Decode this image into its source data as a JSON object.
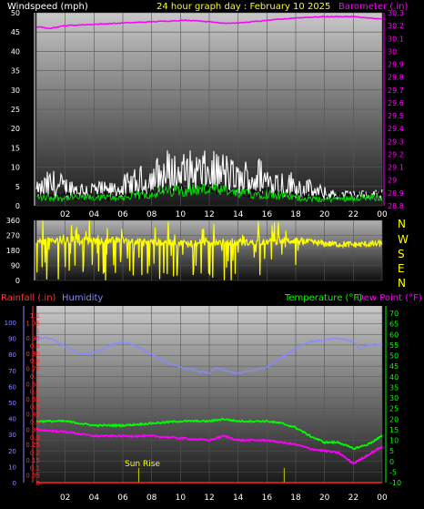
{
  "header": {
    "left": "Windspeed (mph)",
    "center": "24 hour graph day : February 10 2025",
    "right": "Barometer (.in)"
  },
  "compass_letters": [
    "N",
    "W",
    "S",
    "E",
    "N"
  ],
  "colors": {
    "wind": "#ffffff",
    "gust": "#000000",
    "avg": "#00dd00",
    "barometer": "#ff00ff",
    "direction": "#ffff00",
    "humidity": "#8888ff",
    "temperature": "#00ff00",
    "dewpoint": "#ff00ff",
    "rain": "#ff2222",
    "sunline": "#cccc00"
  },
  "x_ticks": [
    "02",
    "04",
    "06",
    "08",
    "10",
    "12",
    "14",
    "16",
    "18",
    "20",
    "22",
    "00"
  ],
  "bottom_header": {
    "rain_label": "Rainfall (.in)",
    "humidity_label": "Humidity",
    "temp_label": "Temperature (°F)",
    "dew_label": "Dew Point (°F)"
  },
  "annotations": {
    "sunrise": "Sun Rise"
  },
  "chart_data": [
    {
      "type": "line",
      "name": "wind",
      "xlim": [
        0,
        24
      ],
      "ylim_left": [
        0,
        50
      ],
      "ylim_right": [
        28.8,
        30.3
      ],
      "left_ticks": [
        0,
        5,
        10,
        15,
        20,
        25,
        30,
        35,
        40,
        45,
        50
      ],
      "right_ticks": [
        "28.8",
        "28.9",
        "29",
        "29.1",
        "29.2",
        "29.3",
        "29.4",
        "29.5",
        "29.6",
        "29.7",
        "29.8",
        "29.9",
        "30",
        "30.1",
        "30.2",
        "30.3"
      ],
      "windspeed_max": {
        "x": [
          0,
          1,
          2,
          3,
          4,
          5,
          6,
          7,
          8,
          9,
          10,
          11,
          12,
          13,
          14,
          15,
          16,
          17,
          18,
          19,
          20,
          21,
          22,
          23,
          24
        ],
        "y": [
          6,
          10,
          8,
          7,
          7,
          6,
          8,
          10,
          12,
          15,
          14,
          15,
          14,
          15,
          11,
          14,
          12,
          10,
          9,
          7,
          5,
          4,
          4,
          4,
          5
        ]
      },
      "windspeed_avg": {
        "x": [
          0,
          2,
          4,
          6,
          8,
          10,
          12,
          14,
          16,
          18,
          20,
          22,
          24
        ],
        "y": [
          2,
          2,
          2,
          2,
          3,
          4,
          4,
          3,
          3,
          2,
          1.5,
          2,
          2
        ]
      },
      "barometer": {
        "x": [
          0,
          1,
          2,
          4,
          6,
          8,
          10,
          11,
          12,
          13,
          14,
          15,
          16,
          18,
          20,
          22,
          23,
          24
        ],
        "y": [
          30.19,
          30.18,
          30.2,
          30.21,
          30.22,
          30.23,
          30.24,
          30.24,
          30.23,
          30.22,
          30.22,
          30.23,
          30.24,
          30.26,
          30.27,
          30.27,
          30.26,
          30.25
        ]
      }
    },
    {
      "type": "scatter",
      "name": "wind_direction",
      "xlim": [
        0,
        24
      ],
      "ylim": [
        0,
        360
      ],
      "ticks": [
        0,
        90,
        180,
        270,
        360
      ],
      "typical": {
        "x": [
          0,
          2,
          4,
          6,
          8,
          10,
          12,
          14,
          16,
          18,
          19,
          20,
          22,
          24
        ],
        "y": [
          230,
          240,
          235,
          240,
          230,
          225,
          230,
          225,
          230,
          240,
          230,
          220,
          215,
          220
        ]
      },
      "scatter_range": [
        0,
        360
      ],
      "scatter_until_hour": 18.5
    },
    {
      "type": "line",
      "name": "temp_humidity",
      "xlim": [
        0,
        24
      ],
      "left_ticks_rain": [
        "0",
        "0.05",
        "0.1",
        "0.15",
        "0.2",
        "0.25",
        "0.3",
        "0.35",
        "0.4",
        "0.45",
        "0.5",
        "0.55",
        "0.6",
        "0.65",
        "0.7",
        "0.75",
        "0.8",
        "0.85",
        "0.9",
        "0.95",
        "1",
        "1.05",
        "1.1"
      ],
      "left_ticks_humidity": [
        0,
        10,
        20,
        30,
        40,
        50,
        60,
        70,
        80,
        90,
        100
      ],
      "right_ticks_temp": [
        -10,
        -5,
        0,
        5,
        10,
        15,
        20,
        25,
        30,
        35,
        40,
        45,
        50,
        55,
        60,
        65,
        70
      ],
      "humidity": {
        "x": [
          0,
          1,
          2,
          3,
          4,
          5,
          6,
          7,
          8,
          9,
          10,
          11,
          12,
          12.5,
          13,
          14,
          15,
          16,
          17,
          18,
          19,
          20,
          21,
          22,
          22.5,
          23,
          24
        ],
        "y": [
          90,
          90,
          85,
          80,
          81,
          85,
          88,
          85,
          80,
          75,
          72,
          70,
          68,
          72,
          70,
          68,
          70,
          72,
          78,
          84,
          88,
          89,
          90,
          88,
          83,
          86,
          86
        ]
      },
      "temperature": {
        "x": [
          0,
          2,
          4,
          6,
          8,
          10,
          12,
          13,
          14,
          16,
          17,
          18,
          19,
          20,
          21,
          22,
          23,
          24
        ],
        "y": [
          19,
          19,
          17,
          17,
          18,
          19,
          19,
          20,
          19,
          19,
          18,
          16,
          12,
          9,
          9,
          6,
          8,
          12
        ]
      },
      "dewpoint": {
        "x": [
          0,
          2,
          4,
          6,
          8,
          10,
          12,
          13,
          14,
          16,
          17,
          18,
          19,
          20,
          21,
          22,
          23,
          24
        ],
        "y": [
          15,
          14,
          12,
          12,
          12,
          11,
          10,
          12,
          10,
          10,
          9,
          8,
          6,
          5,
          4,
          -1,
          3,
          7
        ]
      },
      "rainfall": {
        "x": [
          0,
          24
        ],
        "y": [
          0,
          0
        ]
      },
      "sunrise_hour": 7.1,
      "sunset_hour": 17.2
    }
  ]
}
